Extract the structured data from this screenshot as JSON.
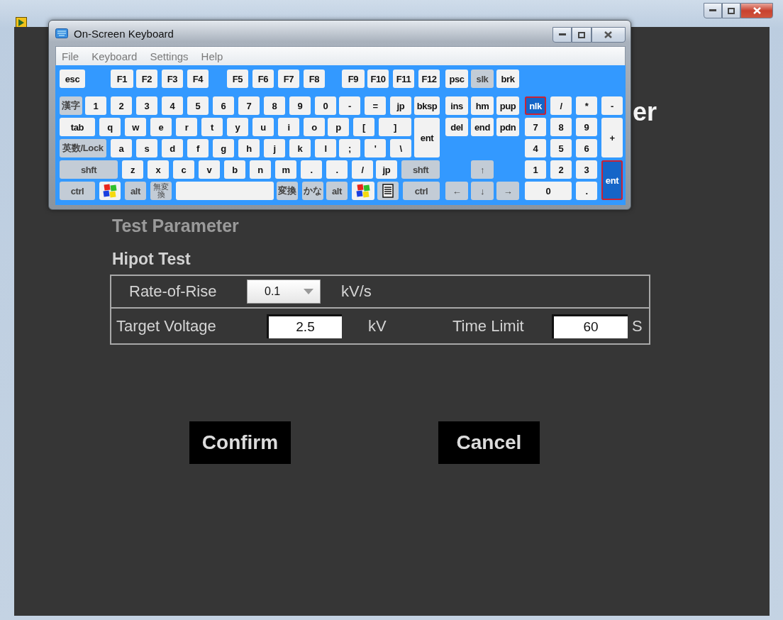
{
  "window": {
    "title_fragment": "er"
  },
  "keyboard": {
    "title": "On-Screen Keyboard",
    "menu": [
      "File",
      "Keyboard",
      "Settings",
      "Help"
    ],
    "rows": [
      {
        "keys": [
          {
            "kind": "text",
            "label": "esc",
            "dim": false,
            "toggled": false
          },
          {
            "kind": "text",
            "label": "F1",
            "dim": false,
            "toggled": false
          },
          {
            "kind": "text",
            "label": "F2",
            "dim": false,
            "toggled": false
          },
          {
            "kind": "text",
            "label": "F3",
            "dim": false,
            "toggled": false
          },
          {
            "kind": "text",
            "label": "F4",
            "dim": false,
            "toggled": false
          },
          {
            "kind": "text",
            "label": "F5",
            "dim": false,
            "toggled": false
          },
          {
            "kind": "text",
            "label": "F6",
            "dim": false,
            "toggled": false
          },
          {
            "kind": "text",
            "label": "F7",
            "dim": false,
            "toggled": false
          },
          {
            "kind": "text",
            "label": "F8",
            "dim": false,
            "toggled": false
          },
          {
            "kind": "text",
            "label": "F9",
            "dim": false,
            "toggled": false
          },
          {
            "kind": "text",
            "label": "F10",
            "dim": false,
            "toggled": false
          },
          {
            "kind": "text",
            "label": "F11",
            "dim": false,
            "toggled": false
          },
          {
            "kind": "text",
            "label": "F12",
            "dim": false,
            "toggled": false
          },
          {
            "kind": "text",
            "label": "psc",
            "dim": false,
            "toggled": false
          },
          {
            "kind": "text",
            "label": "slk",
            "dim": true,
            "toggled": false
          },
          {
            "kind": "text",
            "label": "brk",
            "dim": false,
            "toggled": false
          }
        ]
      },
      {
        "keys": [
          {
            "kind": "text",
            "label": "漢字",
            "dim": true,
            "toggled": false
          },
          {
            "kind": "text",
            "label": "1",
            "dim": false,
            "toggled": false
          },
          {
            "kind": "text",
            "label": "2",
            "dim": false,
            "toggled": false
          },
          {
            "kind": "text",
            "label": "3",
            "dim": false,
            "toggled": false
          },
          {
            "kind": "text",
            "label": "4",
            "dim": false,
            "toggled": false
          },
          {
            "kind": "text",
            "label": "5",
            "dim": false,
            "toggled": false
          },
          {
            "kind": "text",
            "label": "6",
            "dim": false,
            "toggled": false
          },
          {
            "kind": "text",
            "label": "7",
            "dim": false,
            "toggled": false
          },
          {
            "kind": "text",
            "label": "8",
            "dim": false,
            "toggled": false
          },
          {
            "kind": "text",
            "label": "9",
            "dim": false,
            "toggled": false
          },
          {
            "kind": "text",
            "label": "0",
            "dim": false,
            "toggled": false
          },
          {
            "kind": "text",
            "label": "-",
            "dim": false,
            "toggled": false
          },
          {
            "kind": "text",
            "label": "=",
            "dim": false,
            "toggled": false
          },
          {
            "kind": "text",
            "label": "jp",
            "dim": false,
            "toggled": false
          },
          {
            "kind": "text",
            "label": "bksp",
            "dim": false,
            "toggled": false
          },
          {
            "kind": "text",
            "label": "ins",
            "dim": false,
            "toggled": false
          },
          {
            "kind": "text",
            "label": "hm",
            "dim": false,
            "toggled": false
          },
          {
            "kind": "text",
            "label": "pup",
            "dim": false,
            "toggled": false
          },
          {
            "kind": "text",
            "label": "nlk",
            "dim": false,
            "toggled": true
          },
          {
            "kind": "text",
            "label": "/",
            "dim": false,
            "toggled": false
          },
          {
            "kind": "text",
            "label": "*",
            "dim": false,
            "toggled": false
          },
          {
            "kind": "text",
            "label": "-",
            "dim": false,
            "toggled": false
          }
        ]
      },
      {
        "keys": [
          {
            "kind": "text",
            "label": "tab",
            "dim": false,
            "toggled": false
          },
          {
            "kind": "text",
            "label": "q",
            "dim": false,
            "toggled": false
          },
          {
            "kind": "text",
            "label": "w",
            "dim": false,
            "toggled": false
          },
          {
            "kind": "text",
            "label": "e",
            "dim": false,
            "toggled": false
          },
          {
            "kind": "text",
            "label": "r",
            "dim": false,
            "toggled": false
          },
          {
            "kind": "text",
            "label": "t",
            "dim": false,
            "toggled": false
          },
          {
            "kind": "text",
            "label": "y",
            "dim": false,
            "toggled": false
          },
          {
            "kind": "text",
            "label": "u",
            "dim": false,
            "toggled": false
          },
          {
            "kind": "text",
            "label": "i",
            "dim": false,
            "toggled": false
          },
          {
            "kind": "text",
            "label": "o",
            "dim": false,
            "toggled": false
          },
          {
            "kind": "text",
            "label": "p",
            "dim": false,
            "toggled": false
          },
          {
            "kind": "text",
            "label": "[",
            "dim": false,
            "toggled": false
          },
          {
            "kind": "text",
            "label": "]",
            "dim": false,
            "toggled": false
          },
          {
            "kind": "text",
            "label": "ent",
            "dim": false,
            "toggled": false
          },
          {
            "kind": "text",
            "label": "del",
            "dim": false,
            "toggled": false
          },
          {
            "kind": "text",
            "label": "end",
            "dim": false,
            "toggled": false
          },
          {
            "kind": "text",
            "label": "pdn",
            "dim": false,
            "toggled": false
          },
          {
            "kind": "text",
            "label": "7",
            "dim": false,
            "toggled": false
          },
          {
            "kind": "text",
            "label": "8",
            "dim": false,
            "toggled": false
          },
          {
            "kind": "text",
            "label": "9",
            "dim": false,
            "toggled": false
          },
          {
            "kind": "text",
            "label": "+",
            "dim": false,
            "toggled": false
          }
        ]
      },
      {
        "keys": [
          {
            "kind": "text",
            "label": "英数/Lock",
            "dim": true,
            "toggled": false
          },
          {
            "kind": "text",
            "label": "a",
            "dim": false,
            "toggled": false
          },
          {
            "kind": "text",
            "label": "s",
            "dim": false,
            "toggled": false
          },
          {
            "kind": "text",
            "label": "d",
            "dim": false,
            "toggled": false
          },
          {
            "kind": "text",
            "label": "f",
            "dim": false,
            "toggled": false
          },
          {
            "kind": "text",
            "label": "g",
            "dim": false,
            "toggled": false
          },
          {
            "kind": "text",
            "label": "h",
            "dim": false,
            "toggled": false
          },
          {
            "kind": "text",
            "label": "j",
            "dim": false,
            "toggled": false
          },
          {
            "kind": "text",
            "label": "k",
            "dim": false,
            "toggled": false
          },
          {
            "kind": "text",
            "label": "l",
            "dim": false,
            "toggled": false
          },
          {
            "kind": "text",
            "label": ";",
            "dim": false,
            "toggled": false
          },
          {
            "kind": "text",
            "label": "'",
            "dim": false,
            "toggled": false
          },
          {
            "kind": "text",
            "label": "\\",
            "dim": false,
            "toggled": false
          },
          {
            "kind": "text",
            "label": "4",
            "dim": false,
            "toggled": false
          },
          {
            "kind": "text",
            "label": "5",
            "dim": false,
            "toggled": false
          },
          {
            "kind": "text",
            "label": "6",
            "dim": false,
            "toggled": false
          }
        ]
      },
      {
        "keys": [
          {
            "kind": "text",
            "label": "shft",
            "dim": true,
            "toggled": false
          },
          {
            "kind": "text",
            "label": "z",
            "dim": false,
            "toggled": false
          },
          {
            "kind": "text",
            "label": "x",
            "dim": false,
            "toggled": false
          },
          {
            "kind": "text",
            "label": "c",
            "dim": false,
            "toggled": false
          },
          {
            "kind": "text",
            "label": "v",
            "dim": false,
            "toggled": false
          },
          {
            "kind": "text",
            "label": "b",
            "dim": false,
            "toggled": false
          },
          {
            "kind": "text",
            "label": "n",
            "dim": false,
            "toggled": false
          },
          {
            "kind": "text",
            "label": "m",
            "dim": false,
            "toggled": false
          },
          {
            "kind": "text",
            "label": ".",
            "dim": false,
            "toggled": false
          },
          {
            "kind": "text",
            "label": ".",
            "dim": false,
            "toggled": false
          },
          {
            "kind": "text",
            "label": "/",
            "dim": false,
            "toggled": false
          },
          {
            "kind": "text",
            "label": "jp",
            "dim": false,
            "toggled": false
          },
          {
            "kind": "text",
            "label": "shft",
            "dim": true,
            "toggled": false
          },
          {
            "kind": "text",
            "label": "↑",
            "dim": true,
            "toggled": false
          },
          {
            "kind": "text",
            "label": "1",
            "dim": false,
            "toggled": false
          },
          {
            "kind": "text",
            "label": "2",
            "dim": false,
            "toggled": false
          },
          {
            "kind": "text",
            "label": "3",
            "dim": false,
            "toggled": false
          },
          {
            "kind": "text",
            "label": "ent",
            "dim": false,
            "toggled": true
          }
        ]
      },
      {
        "keys": [
          {
            "kind": "text",
            "label": "ctrl",
            "dim": true,
            "toggled": false
          },
          {
            "kind": "logo",
            "dim": false,
            "toggled": false
          },
          {
            "kind": "text",
            "label": "alt",
            "dim": true,
            "toggled": false
          },
          {
            "kind": "text",
            "label": "無変換",
            "dim": true,
            "toggled": false
          },
          {
            "kind": "space",
            "dim": false,
            "toggled": false
          },
          {
            "kind": "text",
            "label": "変換",
            "dim": true,
            "toggled": false
          },
          {
            "kind": "text",
            "label": "かな",
            "dim": true,
            "toggled": false
          },
          {
            "kind": "text",
            "label": "alt",
            "dim": true,
            "toggled": false
          },
          {
            "kind": "logo",
            "dim": false,
            "toggled": false
          },
          {
            "kind": "menu",
            "dim": true,
            "toggled": false
          },
          {
            "kind": "text",
            "label": "ctrl",
            "dim": true,
            "toggled": false
          },
          {
            "kind": "text",
            "label": "←",
            "dim": true,
            "toggled": false
          },
          {
            "kind": "text",
            "label": "↓",
            "dim": true,
            "toggled": false
          },
          {
            "kind": "text",
            "label": "→",
            "dim": true,
            "toggled": false
          },
          {
            "kind": "text",
            "label": "0",
            "dim": false,
            "toggled": false
          },
          {
            "kind": "text",
            "label": ".",
            "dim": false,
            "toggled": false
          }
        ]
      }
    ]
  },
  "section_title": "Test Parameter",
  "group_title": "Hipot Test",
  "parameter_rows": [
    {
      "params": [
        {
          "label": "Rate-of-Rise",
          "kind": "dropdown",
          "value": "0.1",
          "unit": "kV/s"
        }
      ]
    },
    {
      "params": [
        {
          "label": "Target Voltage",
          "kind": "input",
          "value": "2.5",
          "unit": "kV"
        },
        {
          "label": "Time Limit",
          "kind": "input",
          "value": "60",
          "unit": "S"
        }
      ]
    }
  ],
  "buttons": [
    "Confirm",
    "Cancel"
  ]
}
